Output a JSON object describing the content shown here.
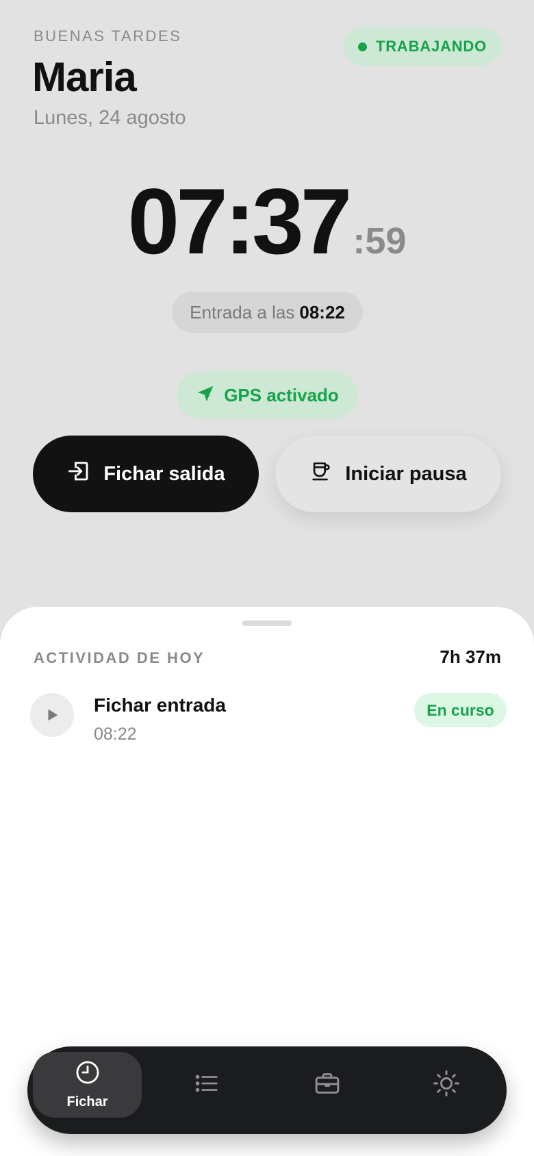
{
  "header": {
    "greeting": "BUENAS TARDES",
    "user_name": "Maria",
    "date": "Lunes, 24 agosto",
    "status_label": "TRABAJANDO",
    "status_color": "#16a34a"
  },
  "clock": {
    "hours_minutes": "07:37",
    "seconds": ":59"
  },
  "entry": {
    "label": "Entrada a las",
    "time": "08:22"
  },
  "gps": {
    "label": "GPS activado",
    "icon": "navigation-arrow-icon"
  },
  "actions": {
    "clock_out_label": "Fichar salida",
    "clock_out_icon": "sign-in-icon",
    "pause_label": "Iniciar pausa",
    "pause_icon": "coffee-cup-icon"
  },
  "activity": {
    "title": "ACTIVIDAD DE HOY",
    "total": "7h 37m",
    "items": [
      {
        "title": "Fichar entrada",
        "time": "08:22",
        "badge": "En curso",
        "icon": "play-icon"
      }
    ]
  },
  "nav": {
    "items": [
      {
        "label": "Fichar",
        "icon": "clock-icon",
        "active": true
      },
      {
        "label": "",
        "icon": "list-icon",
        "active": false
      },
      {
        "label": "",
        "icon": "briefcase-icon",
        "active": false
      },
      {
        "label": "",
        "icon": "sun-icon",
        "active": false
      }
    ]
  },
  "colors": {
    "accent_green": "#16a34a",
    "green_pill_bg": "#cde9d6",
    "dark": "#121212",
    "background": "#e2e2e2"
  }
}
